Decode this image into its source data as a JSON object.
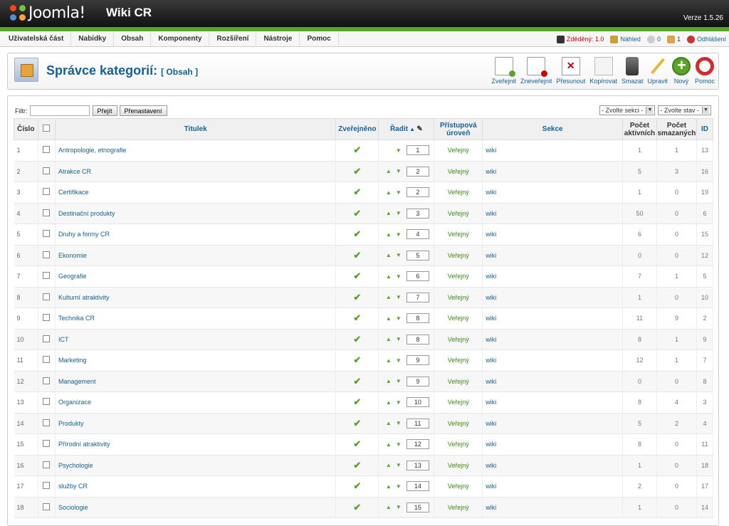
{
  "header": {
    "logo_text": "Joomla!",
    "site_name": "Wiki CR",
    "version": "Verze 1.5.26"
  },
  "menu": [
    "Uživatelská část",
    "Nabídky",
    "Obsah",
    "Komponenty",
    "Rozšíření",
    "Nástroje",
    "Pomoc"
  ],
  "status": {
    "inherited": "Zděděný: 1.0",
    "preview": "Náhled",
    "messages": "0",
    "users": "1",
    "logout": "Odhlášení"
  },
  "page": {
    "title": "Správce kategorií:",
    "subtitle": "[ Obsah ]"
  },
  "toolbar": [
    "Zveřejnit",
    "Zneveřejnit",
    "Přesunout",
    "Kopírovat",
    "Smazat",
    "Upravit",
    "Nový",
    "Pomoc"
  ],
  "filter": {
    "label": "Filtr:",
    "go": "Přejít",
    "reset": "Přenastavení",
    "section_select": "- Zvolte sekci -",
    "state_select": "- Zvolte stav -"
  },
  "columns": {
    "num": "Číslo",
    "title": "Titulek",
    "published": "Zveřejněno",
    "order": "Řadit",
    "access_1": "Přístupová",
    "access_2": "úroveň",
    "section": "Sekce",
    "active_1": "Počet",
    "active_2": "aktivních",
    "trash_1": "Počet",
    "trash_2": "smazaných",
    "id": "ID"
  },
  "rows": [
    {
      "n": "1",
      "title": "Antropologie, etnografie",
      "order": "1",
      "access": "Veřejný",
      "section": "wiki",
      "active": "1",
      "trash": "1",
      "id": "13",
      "up": false
    },
    {
      "n": "2",
      "title": "Atrakce CR",
      "order": "2",
      "access": "Veřejný",
      "section": "wiki",
      "active": "5",
      "trash": "3",
      "id": "16",
      "up": true
    },
    {
      "n": "3",
      "title": "Certifikace",
      "order": "2",
      "access": "Veřejný",
      "section": "wiki",
      "active": "1",
      "trash": "0",
      "id": "19",
      "up": true
    },
    {
      "n": "4",
      "title": "Destinační produkty",
      "order": "3",
      "access": "Veřejný",
      "section": "wiki",
      "active": "50",
      "trash": "0",
      "id": "6",
      "up": true
    },
    {
      "n": "5",
      "title": "Druhy a formy CR",
      "order": "4",
      "access": "Veřejný",
      "section": "wiki",
      "active": "6",
      "trash": "0",
      "id": "15",
      "up": true
    },
    {
      "n": "6",
      "title": "Ekonomie",
      "order": "5",
      "access": "Veřejný",
      "section": "wiki",
      "active": "0",
      "trash": "0",
      "id": "12",
      "up": true
    },
    {
      "n": "7",
      "title": "Geografie",
      "order": "6",
      "access": "Veřejný",
      "section": "wiki",
      "active": "7",
      "trash": "1",
      "id": "5",
      "up": true
    },
    {
      "n": "8",
      "title": "Kulturní atraktivity",
      "order": "7",
      "access": "Veřejný",
      "section": "wiki",
      "active": "1",
      "trash": "0",
      "id": "10",
      "up": true
    },
    {
      "n": "9",
      "title": "Technika CR",
      "order": "8",
      "access": "Veřejný",
      "section": "wiki",
      "active": "11",
      "trash": "9",
      "id": "2",
      "up": true
    },
    {
      "n": "10",
      "title": "ICT",
      "order": "8",
      "access": "Veřejný",
      "section": "wiki",
      "active": "8",
      "trash": "1",
      "id": "9",
      "up": true
    },
    {
      "n": "11",
      "title": "Marketing",
      "order": "9",
      "access": "Veřejný",
      "section": "wiki",
      "active": "12",
      "trash": "1",
      "id": "7",
      "up": true
    },
    {
      "n": "12",
      "title": "Management",
      "order": "9",
      "access": "Veřejný",
      "section": "wiki",
      "active": "0",
      "trash": "0",
      "id": "8",
      "up": true
    },
    {
      "n": "13",
      "title": "Organizace",
      "order": "10",
      "access": "Veřejný",
      "section": "wiki",
      "active": "8",
      "trash": "4",
      "id": "3",
      "up": true
    },
    {
      "n": "14",
      "title": "Produkty",
      "order": "11",
      "access": "Veřejný",
      "section": "wiki",
      "active": "5",
      "trash": "2",
      "id": "4",
      "up": true
    },
    {
      "n": "15",
      "title": "Přírodní atraktivity",
      "order": "12",
      "access": "Veřejný",
      "section": "wiki",
      "active": "8",
      "trash": "0",
      "id": "11",
      "up": true
    },
    {
      "n": "16",
      "title": "Psychologie",
      "order": "13",
      "access": "Veřejný",
      "section": "wiki",
      "active": "1",
      "trash": "0",
      "id": "18",
      "up": true
    },
    {
      "n": "17",
      "title": "služby CR",
      "order": "14",
      "access": "Veřejný",
      "section": "wiki",
      "active": "2",
      "trash": "0",
      "id": "17",
      "up": true
    },
    {
      "n": "18",
      "title": "Sociologie",
      "order": "15",
      "access": "Veřejný",
      "section": "wiki",
      "active": "1",
      "trash": "0",
      "id": "14",
      "up": true
    }
  ]
}
